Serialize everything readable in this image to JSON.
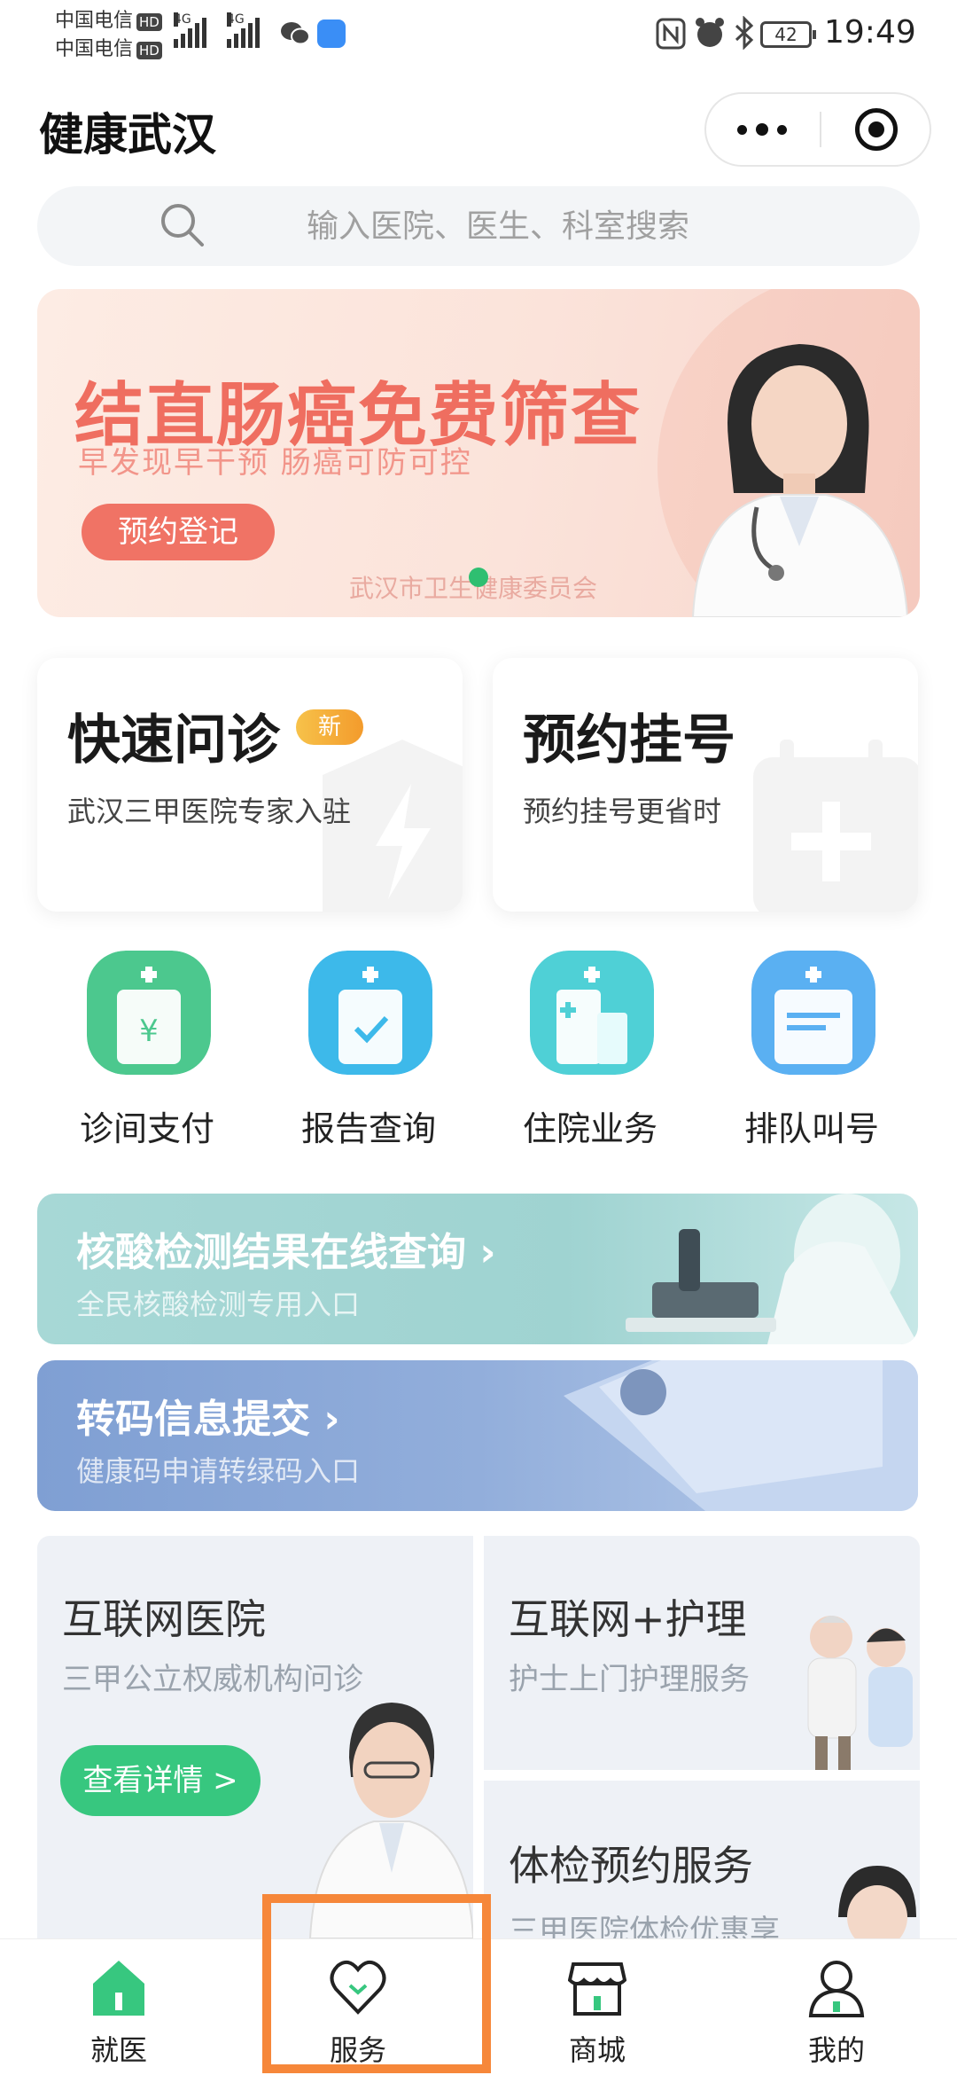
{
  "status_bar": {
    "carrier_1": "中国电信",
    "carrier_2": "中国电信",
    "hd_badge": "HD",
    "network_1": "4G",
    "network_2": "4G",
    "battery": "42",
    "time": "19:49"
  },
  "header": {
    "title": "健康武汉"
  },
  "search": {
    "placeholder": "输入医院、医生、科室搜索"
  },
  "banner": {
    "title": "结直肠癌免费筛查",
    "subtitle": "早发现早干预  肠癌可防可控",
    "button": "预约登记",
    "organization": "武汉市卫生健康委员会"
  },
  "quick_cards": [
    {
      "title": "快速问诊",
      "badge": "新",
      "subtitle": "武汉三甲医院专家入驻"
    },
    {
      "title": "预约挂号",
      "subtitle": "预约挂号更省时"
    }
  ],
  "services": [
    {
      "label": "诊间支付",
      "icon": "payment-icon",
      "color": "#4cc88e"
    },
    {
      "label": "报告查询",
      "icon": "report-icon",
      "color": "#3db9ea"
    },
    {
      "label": "住院业务",
      "icon": "hospital-icon",
      "color": "#4fd0d6"
    },
    {
      "label": "排队叫号",
      "icon": "queue-icon",
      "color": "#5ab0f2"
    }
  ],
  "promos": [
    {
      "title": "核酸检测结果在线查询 ›",
      "subtitle": "全民核酸检测专用入口"
    },
    {
      "title": "转码信息提交 ›",
      "subtitle": "健康码申请转绿码入口"
    }
  ],
  "service_cards": {
    "internet_hospital": {
      "title": "互联网医院",
      "subtitle": "三甲公立权威机构问诊",
      "button": "查看详情 >"
    },
    "nursing": {
      "title": "互联网+护理",
      "subtitle": "护士上门护理服务"
    },
    "checkup": {
      "title": "体检预约服务",
      "subtitle": "三甲医院体检优惠享"
    }
  },
  "tabbar": [
    {
      "label": "就医",
      "icon": "home-icon",
      "active": true
    },
    {
      "label": "服务",
      "icon": "heart-icon",
      "active": false
    },
    {
      "label": "商城",
      "icon": "store-icon",
      "active": false
    },
    {
      "label": "我的",
      "icon": "user-icon",
      "active": false
    }
  ],
  "colors": {
    "brand_green": "#37c77f",
    "banner_red": "#ef6e60",
    "highlight_orange": "#f6873a"
  }
}
